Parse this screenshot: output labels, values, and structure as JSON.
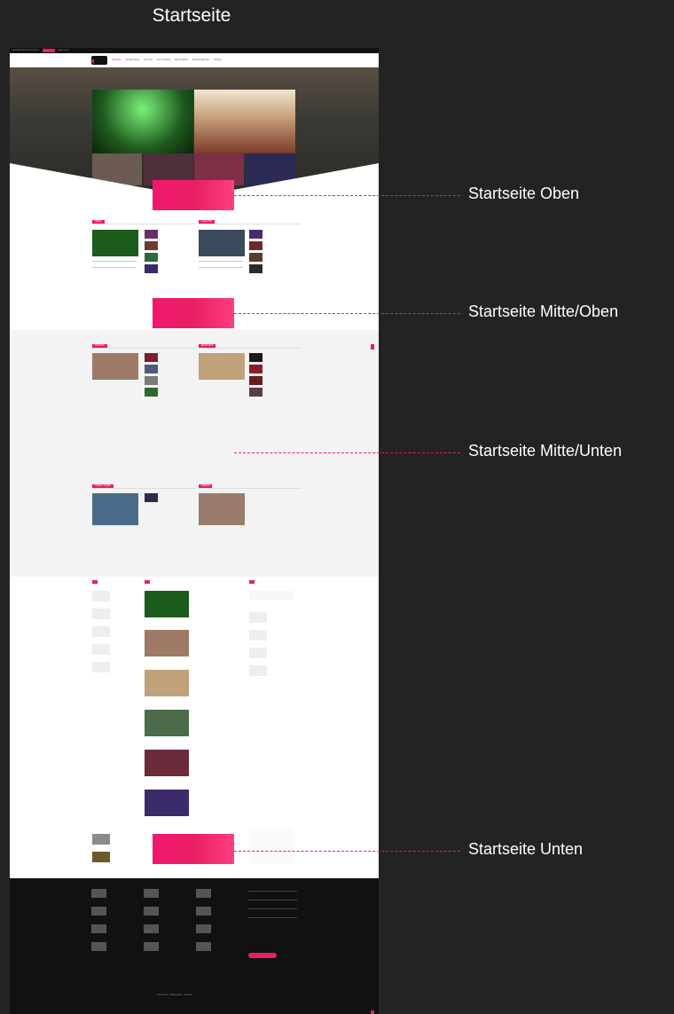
{
  "page_title": "Startseite",
  "colors": {
    "accent": "#e91e63",
    "background": "#232323",
    "footer": "#111111"
  },
  "topbar": {
    "text_left": "FESTIVAL NEWS UND TICKETS",
    "text_right": "HARD CLUB"
  },
  "navbar": {
    "items": [
      "Startseite",
      "Festival News",
      "Line-Ups",
      "Event Tickets",
      "Alle Festivals",
      "Festival Kalender",
      "Kontakt"
    ],
    "active_index": 0
  },
  "annotations": [
    {
      "label": "Startseite Oben"
    },
    {
      "label": "Startseite Mitte/Oben"
    },
    {
      "label": "Startseite Mitte/Unten"
    },
    {
      "label": "Startseite Unten"
    }
  ],
  "sections": [
    {
      "label": "NEWS"
    },
    {
      "label": "LINE-UPS"
    },
    {
      "label": "TICKETS"
    },
    {
      "label": "FESTIVALS"
    },
    {
      "label": "HOTEL / CAMP"
    },
    {
      "label": "VIDEOS"
    }
  ],
  "footer": {
    "bottom_links": [
      "Impressum",
      "Datenschutz",
      "Kontakt"
    ]
  }
}
